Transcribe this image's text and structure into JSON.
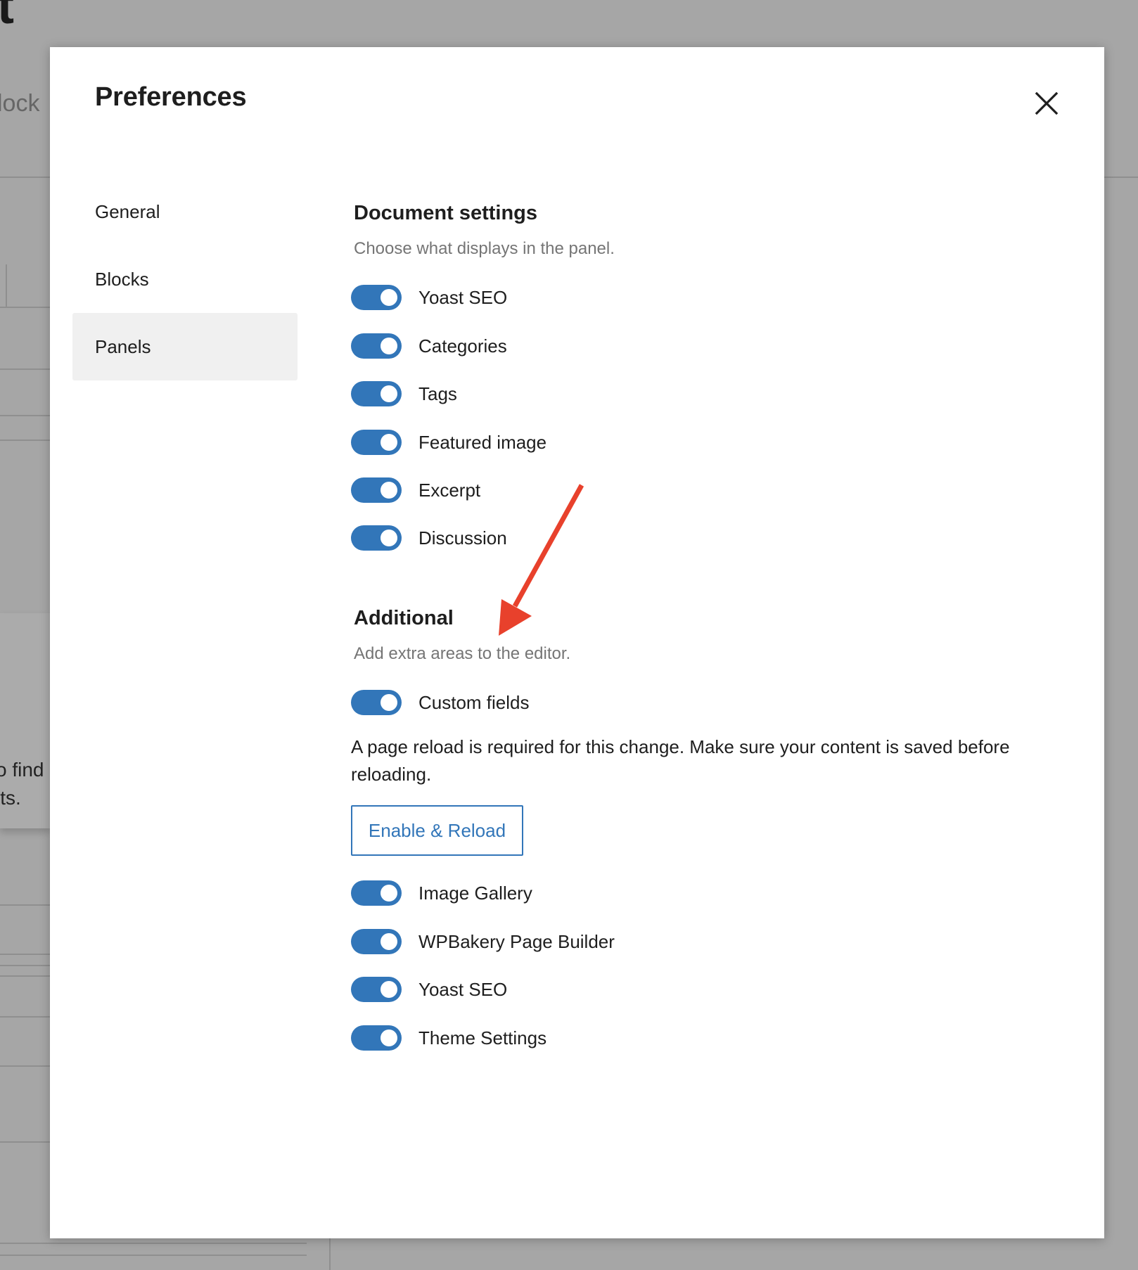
{
  "background": {
    "big_letter": "t",
    "fragment_word": "lock",
    "fragment_lines": [
      "o find",
      "lts."
    ]
  },
  "modal": {
    "title": "Preferences",
    "close_icon": "close-icon"
  },
  "nav": {
    "items": [
      {
        "label": "General",
        "active": false
      },
      {
        "label": "Blocks",
        "active": false
      },
      {
        "label": "Panels",
        "active": true
      }
    ]
  },
  "document_settings": {
    "title": "Document settings",
    "description": "Choose what displays in the panel.",
    "toggles": [
      {
        "label": "Yoast SEO",
        "enabled": true
      },
      {
        "label": "Categories",
        "enabled": true
      },
      {
        "label": "Tags",
        "enabled": true
      },
      {
        "label": "Featured image",
        "enabled": true
      },
      {
        "label": "Excerpt",
        "enabled": true
      },
      {
        "label": "Discussion",
        "enabled": true
      }
    ]
  },
  "additional": {
    "title": "Additional",
    "description": "Add extra areas to the editor.",
    "custom_fields": {
      "label": "Custom fields",
      "enabled": true
    },
    "reload_note": "A page reload is required for this change. Make sure your content is saved before reloading.",
    "reload_button": "Enable & Reload",
    "toggles": [
      {
        "label": "Image Gallery",
        "enabled": true
      },
      {
        "label": "WPBakery Page Builder",
        "enabled": true
      },
      {
        "label": "Yoast SEO",
        "enabled": true
      },
      {
        "label": "Theme Settings",
        "enabled": true
      }
    ]
  },
  "colors": {
    "accent": "#3276b9",
    "annotation_arrow": "#e8412c",
    "overlay": "#a6a6a6",
    "nav_active_bg": "#f0f0f0"
  }
}
